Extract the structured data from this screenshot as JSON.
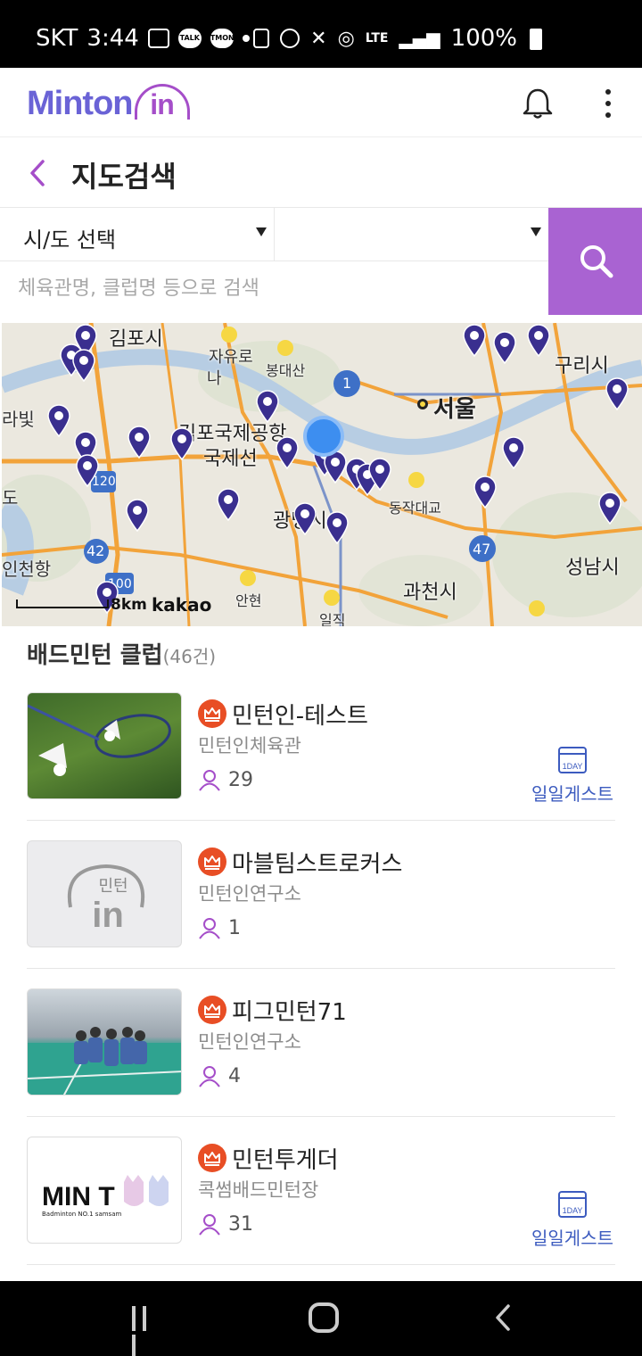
{
  "status_bar": {
    "carrier": "SKT",
    "time": "3:44",
    "network": "LTE",
    "battery": "100%"
  },
  "app": {
    "logo_text": "Minton",
    "logo_suffix": "in"
  },
  "page": {
    "title": "지도검색"
  },
  "filters": {
    "region_label": "시/도 선택",
    "district_label": "",
    "search_placeholder": "체육관명, 클럽명 등으로 검색"
  },
  "map": {
    "labels": {
      "gimpo": "김포시",
      "jayuro": "자유로",
      "na": "나",
      "bonghwasan": "봉대산",
      "seoul": "서울",
      "guri": "구리시",
      "gimpo_airport": "김포국제공항",
      "gukje": "국제선",
      "gwangmyeong": "광명시",
      "dongjak": "동작대교",
      "seongnam": "성남시",
      "gwacheon": "과천시",
      "incheon_port": "인천항",
      "ilbit": "라빛",
      "do": "도",
      "anhyeon": "안현",
      "iljik": "일직",
      "road_1": "1",
      "road_120": "120",
      "road_42": "42",
      "road_47": "47",
      "road_100": "100"
    },
    "scale": "8km",
    "attribution": "kakao"
  },
  "list": {
    "heading": "배드민턴 클럽",
    "count": "(46건)",
    "guest_label": "일일게스트",
    "guest_badge": "1DAY",
    "clubs": [
      {
        "name": "민턴인-테스트",
        "place": "민턴인체육관",
        "members": "29",
        "guest": true
      },
      {
        "name": "마블팀스트로커스",
        "place": "민턴인연구소",
        "members": "1",
        "guest": false
      },
      {
        "name": "피그민턴71",
        "place": "민턴인연구소",
        "members": "4",
        "guest": false
      },
      {
        "name": "민턴투게더",
        "place": "콕썸배드민턴장",
        "members": "31",
        "guest": true
      }
    ],
    "thumb_logo_text": "민턴",
    "thumb_logo_in": "in",
    "thumb_mint_text": "MIN T",
    "thumb_mint_sub": "Badminton NO.1 samsam"
  }
}
